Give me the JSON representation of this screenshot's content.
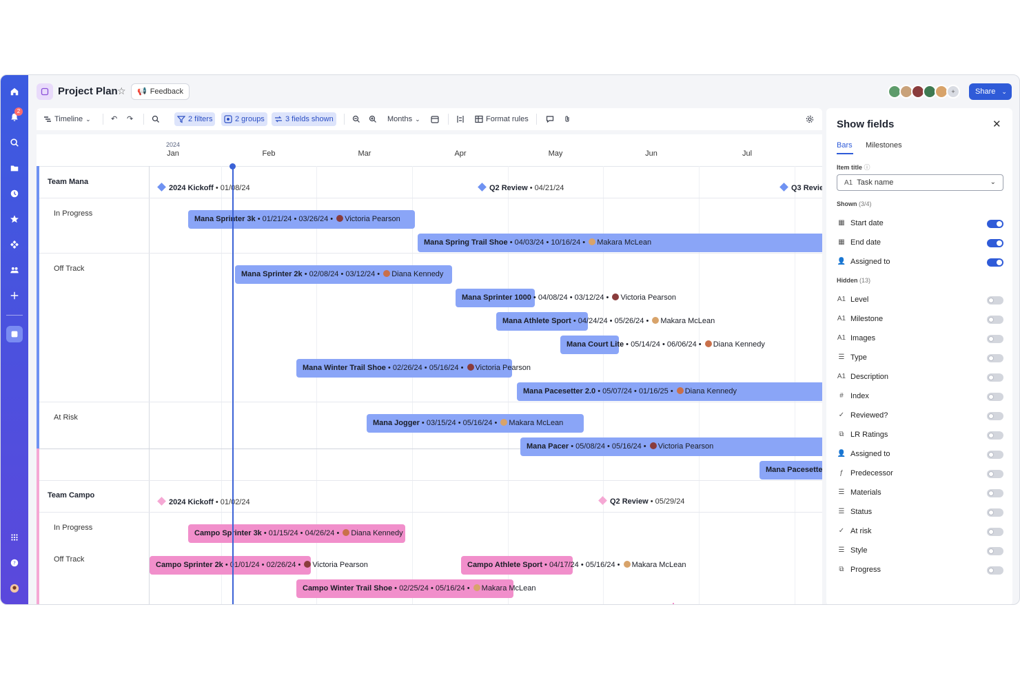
{
  "header": {
    "project_title": "Project Plan",
    "feedback_label": "Feedback",
    "share_label": "Share",
    "avatar_overflow": "+"
  },
  "toolbar": {
    "view_label": "Timeline",
    "filters_label": "2 filters",
    "groups_label": "2 groups",
    "fields_label": "3 fields shown",
    "scale_label": "Months",
    "format_rules_label": "Format rules"
  },
  "rail": {
    "notification_count": "2"
  },
  "timeline": {
    "year": "2024",
    "months": [
      "Jan",
      "Feb",
      "Mar",
      "Apr",
      "May",
      "Jun",
      "Jul"
    ],
    "groups": [
      {
        "name": "Team Mana",
        "color": "#6f92f2",
        "milestones": [
          {
            "name": "2024 Kickoff",
            "date": "01/08/24"
          },
          {
            "name": "Q2 Review",
            "date": "04/21/24"
          },
          {
            "name": "Q3 Revie",
            "date": ""
          }
        ],
        "rows": [
          {
            "label": "In Progress"
          },
          {
            "label": "Off Track"
          },
          {
            "label": "At Risk"
          }
        ],
        "bars": [
          {
            "name": "Mana Sprinter 3k",
            "start": "01/21/24",
            "end": "03/26/24",
            "assignee": "Victoria Pearson"
          },
          {
            "name": "Mana Spring Trail Shoe",
            "start": "04/03/24",
            "end": "10/16/24",
            "assignee": "Makara McLean"
          },
          {
            "name": "Mana Sprinter 2k",
            "start": "02/08/24",
            "end": "03/12/24",
            "assignee": "Diana Kennedy"
          },
          {
            "name": "Mana Sprinter 1000",
            "start": "04/08/24",
            "end": "03/12/24",
            "assignee": "Victoria Pearson"
          },
          {
            "name": "Mana Athlete Sport",
            "start": "04/24/24",
            "end": "05/26/24",
            "assignee": "Makara McLean"
          },
          {
            "name": "Mana Court Lite",
            "start": "05/14/24",
            "end": "06/06/24",
            "assignee": "Diana Kennedy"
          },
          {
            "name": "Mana Winter Trail Shoe",
            "start": "02/26/24",
            "end": "05/16/24",
            "assignee": "Victoria Pearson"
          },
          {
            "name": "Mana Pacesetter 2.0",
            "start": "05/07/24",
            "end": "01/16/25",
            "assignee": "Diana Kennedy"
          },
          {
            "name": "Mana Jogger",
            "start": "03/15/24",
            "end": "05/16/24",
            "assignee": "Makara McLean"
          },
          {
            "name": "Mana Pacer",
            "start": "05/08/24",
            "end": "05/16/24",
            "assignee": "Victoria Pearson"
          },
          {
            "name": "Mana Pacesette",
            "start": "",
            "end": "",
            "assignee": ""
          }
        ]
      },
      {
        "name": "Team Campo",
        "color": "#f5a8d4",
        "milestones": [
          {
            "name": "2024 Kickoff",
            "date": "01/02/24"
          },
          {
            "name": "Q2 Review",
            "date": "05/29/24"
          }
        ],
        "rows": [
          {
            "label": "In Progress"
          },
          {
            "label": "Off Track"
          }
        ],
        "bars": [
          {
            "name": "Campo Sprinter 3k",
            "start": "01/15/24",
            "end": "04/26/24",
            "assignee": "Diana Kennedy"
          },
          {
            "name": "Campo Sprinter 2k",
            "start": "01/01/24",
            "end": "02/26/24",
            "assignee": "Victoria Pearson"
          },
          {
            "name": "Campo Athlete Sport",
            "start": "04/17/24",
            "end": "05/16/24",
            "assignee": "Makara McLean"
          },
          {
            "name": "Campo Winter Trail Shoe",
            "start": "02/25/24",
            "end": "05/16/24",
            "assignee": "Makara McLean"
          }
        ]
      }
    ]
  },
  "panel": {
    "title": "Show fields",
    "tabs": [
      "Bars",
      "Milestones"
    ],
    "item_title_label": "Item title",
    "item_title_value": "Task name",
    "shown_label": "Shown",
    "shown_count": "(3/4)",
    "hidden_label": "Hidden",
    "hidden_count": "(13)",
    "shown_fields": [
      "Start date",
      "End date",
      "Assigned to"
    ],
    "hidden_fields": [
      "Level",
      "Milestone",
      "Images",
      "Type",
      "Description",
      "Index",
      "Reviewed?",
      "LR Ratings",
      "Assigned to",
      "Predecessor",
      "Materials",
      "Status",
      "At risk",
      "Style",
      "Progress"
    ]
  },
  "colors": {
    "accent": "#2f5bd8",
    "mana_bar": "#8aa5f7",
    "campo_bar": "#f18fcb"
  }
}
